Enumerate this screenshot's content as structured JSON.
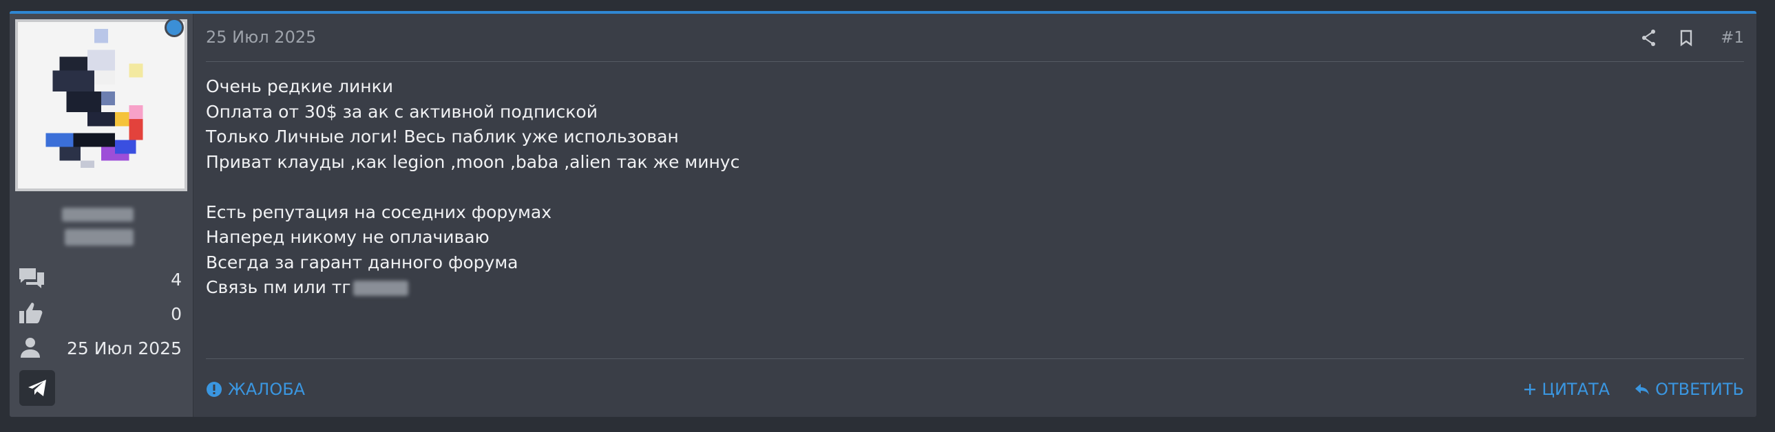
{
  "post": {
    "date": "25 Июл 2025",
    "number": "#1",
    "body_lines": [
      "Очень редкие линки",
      "Оплата от 30$ за ак с активной подпиской",
      "Только Личные логи! Весь паблик уже использован",
      "Приват клауды ,как legion ,moon ,baba ,alien так же минус",
      "",
      "Есть репутация на соседних форумах",
      "Наперед никому не оплачиваю",
      "Всегда за гарант данного форума"
    ],
    "contact_line": "Связь пм или тг",
    "icons": {
      "share": "share-icon",
      "bookmark": "bookmark-icon",
      "report": "alert-circle-icon",
      "quote": "plus-icon",
      "reply": "reply-icon"
    }
  },
  "author": {
    "stats": {
      "messages": "4",
      "reactions": "0",
      "joined": "25 Июл 2025"
    },
    "icons": {
      "messages": "messages-icon",
      "reactions": "thumbs-up-icon",
      "joined": "user-icon",
      "telegram": "telegram-icon"
    }
  },
  "footer": {
    "report_label": "ЖАЛОБА",
    "quote_label": "ЦИТАТА",
    "reply_label": "ОТВЕТИТЬ"
  },
  "colors": {
    "accent": "#2f87d3",
    "link": "#3a96e0",
    "background": "#2b2f36",
    "post_bg": "#3a3e47",
    "sidebar_bg": "#454952"
  }
}
